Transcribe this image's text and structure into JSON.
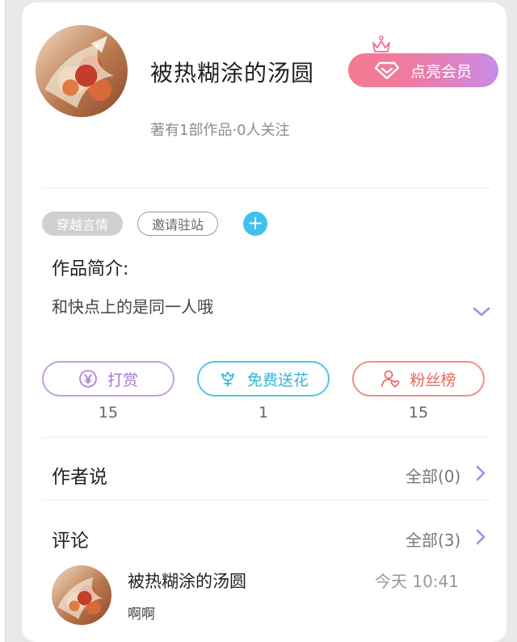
{
  "author": {
    "name": "被热糊涂的汤圆",
    "meta": "著有1部作品·0人关注"
  },
  "vip": {
    "label": "点亮会员"
  },
  "tags": [
    {
      "label": "穿越言情",
      "style": "filled"
    },
    {
      "label": "邀请驻站",
      "style": "outline"
    }
  ],
  "add_tag": {
    "icon": "plus-icon",
    "glyph": "+"
  },
  "intro": {
    "title": "作品简介:",
    "text": "和快点上的是同一人哦"
  },
  "actions": [
    {
      "label": "打赏",
      "count": "15",
      "icon": "yen-coin-icon",
      "color": "#a676d6"
    },
    {
      "label": "免费送花",
      "count": "1",
      "icon": "flower-icon",
      "color": "#2fb6dc"
    },
    {
      "label": "粉丝榜",
      "count": "15",
      "icon": "fan-person-heart-icon",
      "color": "#e76a5d"
    }
  ],
  "author_says": {
    "title": "作者说",
    "more": "全部(0)"
  },
  "comments": {
    "title": "评论",
    "more": "全部(3)",
    "items": [
      {
        "user": "被热糊涂的汤圆",
        "time": "今天 10:41",
        "text": "啊啊"
      }
    ]
  },
  "colors": {
    "accent_purple": "#a98be0",
    "vip_gradient_start": "#f47a8f",
    "vip_gradient_end": "#c98be8"
  }
}
